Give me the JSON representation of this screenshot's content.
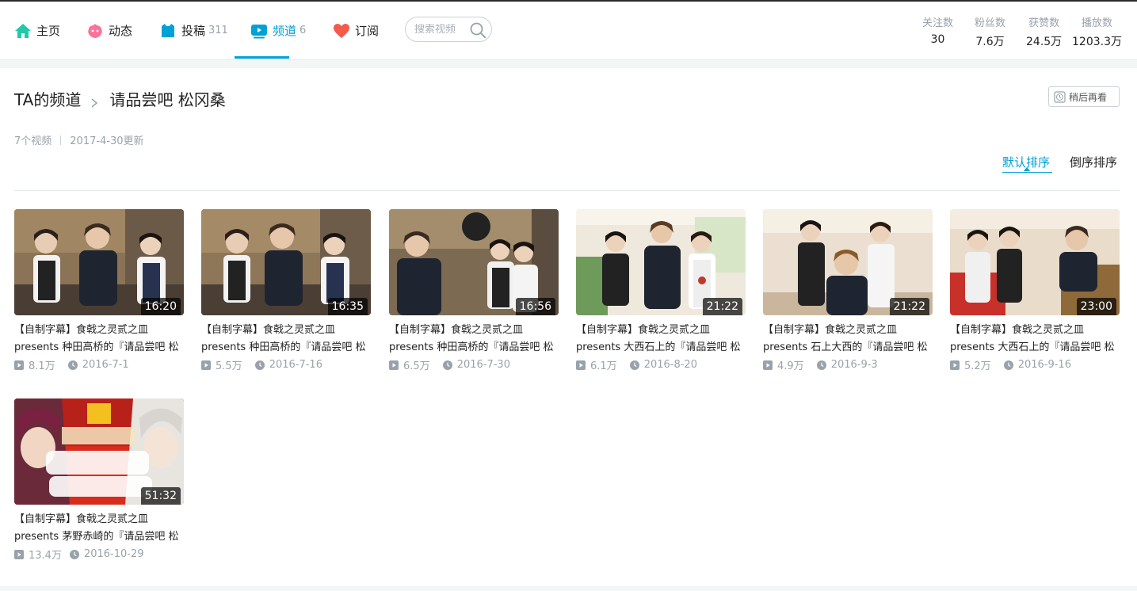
{
  "nav": {
    "items": [
      {
        "label": "主页",
        "count": "",
        "icon": "home-icon"
      },
      {
        "label": "动态",
        "count": "",
        "icon": "dynamic-icon"
      },
      {
        "label": "投稿",
        "count": "311",
        "icon": "upload-icon"
      },
      {
        "label": "频道",
        "count": "6",
        "icon": "channel-icon"
      },
      {
        "label": "订阅",
        "count": "",
        "icon": "heart-icon"
      }
    ],
    "active": "频道",
    "search_placeholder": "搜索视频"
  },
  "stats": [
    {
      "label": "关注数",
      "value": "30"
    },
    {
      "label": "粉丝数",
      "value": "7.6万"
    },
    {
      "label": "获赞数",
      "value": "24.5万"
    },
    {
      "label": "播放数",
      "value": "1203.3万"
    }
  ],
  "header": {
    "root": "TA的频道",
    "channel_name": "请品尝吧 松冈桑",
    "watch_later": "稍后再看",
    "video_count": "7个视频",
    "updated": "2017-4-30更新",
    "sort_default": "默认排序",
    "sort_reverse": "倒序排序"
  },
  "videos": [
    {
      "duration": "16:20",
      "title1": "【自制字幕】食戟之灵贰之皿",
      "title2": "presents 种田高桥的『请品尝吧 松",
      "views": "8.1万",
      "date": "2016-7-1"
    },
    {
      "duration": "16:35",
      "title1": "【自制字幕】食戟之灵贰之皿",
      "title2": "presents 种田高桥的『请品尝吧 松",
      "views": "5.5万",
      "date": "2016-7-16"
    },
    {
      "duration": "16:56",
      "title1": "【自制字幕】食戟之灵贰之皿",
      "title2": "presents 种田高桥的『请品尝吧 松",
      "views": "6.5万",
      "date": "2016-7-30"
    },
    {
      "duration": "21:22",
      "title1": "【自制字幕】食戟之灵贰之皿",
      "title2": "presents 大西石上的『请品尝吧 松",
      "views": "6.1万",
      "date": "2016-8-20"
    },
    {
      "duration": "21:22",
      "title1": "【自制字幕】食戟之灵贰之皿",
      "title2": "presents 石上大西的『请品尝吧 松",
      "views": "4.9万",
      "date": "2016-9-3"
    },
    {
      "duration": "23:00",
      "title1": "【自制字幕】食戟之灵贰之皿",
      "title2": "presents 大西石上的『请品尝吧 松",
      "views": "5.2万",
      "date": "2016-9-16"
    },
    {
      "duration": "51:32",
      "title1": "【自制字幕】食戟之灵贰之皿",
      "title2": "presents 茅野赤崎的『请品尝吧 松",
      "views": "13.4万",
      "date": "2016-10-29"
    }
  ],
  "colors": {
    "accent": "#00a1d6",
    "muted": "#99a2aa",
    "home": "#23c9a6",
    "dynamic": "#fb7299",
    "upload": "#00a1d6",
    "heart": "#f45a4b"
  }
}
